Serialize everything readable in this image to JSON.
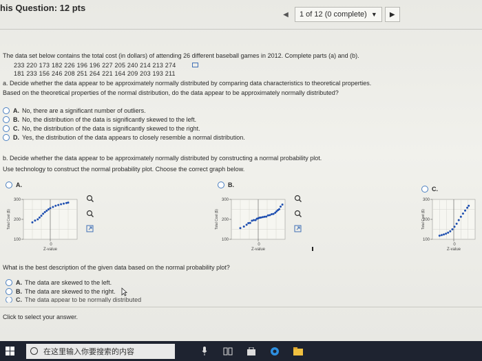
{
  "header": {
    "question_title": "his Question: 12 pts",
    "progress": "1 of 12 (0 complete)"
  },
  "intro": "The data set below contains the total cost (in dollars) of attending 26 different baseball games in 2012. Complete parts (a) and (b).",
  "data_rows": [
    "233  220  173  182  226  196  196  227  205  240  214  213  274",
    "181  233  156  246  208  251  264  221  164  209  203  193  211"
  ],
  "part_a": {
    "prompt": "a. Decide whether the data appear to be approximately normally distributed by comparing data characteristics to theoretical properties.",
    "question": "Based on the theoretical properties of the normal distribution, do the data appear to be approximately normally distributed?",
    "options": [
      {
        "letter": "A.",
        "text": "No, there are a significant number of outliers."
      },
      {
        "letter": "B.",
        "text": "No, the distribution of the data is significantly skewed to the left."
      },
      {
        "letter": "C.",
        "text": "No, the distribution of the data is significantly skewed to the right."
      },
      {
        "letter": "D.",
        "text": "Yes, the distribution of the data appears to closely resemble a normal distribution."
      }
    ]
  },
  "part_b": {
    "prompt": "b. Decide whether the data appear to be approximately normally distributed by constructing a normal probability plot.",
    "instruction": "Use technology to construct the normal probability plot. Choose the correct graph below.",
    "graph_options": [
      "A.",
      "B.",
      "C."
    ],
    "question": "What is the best description of the given data based on the normal probability plot?",
    "options": [
      {
        "letter": "A.",
        "text": "The data are skewed to the left."
      },
      {
        "letter": "B.",
        "text": "The data are skewed to the right."
      },
      {
        "letter": "C.",
        "text": "The data appear to be normally distributed"
      }
    ]
  },
  "footer_hint": "Click to select your answer.",
  "taskbar": {
    "search_placeholder": "在这里输入你要搜索的内容"
  },
  "chart_data": [
    {
      "type": "scatter",
      "title": "",
      "xlabel": "Z-value",
      "ylabel": "Total Cost ($)",
      "ylim": [
        100,
        300
      ],
      "y_ticks": [
        "300",
        "200",
        "100"
      ],
      "x_ticks": [
        "0"
      ],
      "series": [
        {
          "points": [
            [
              -2,
              185
            ],
            [
              -1.7,
              194
            ],
            [
              -1.4,
              200
            ],
            [
              -1.2,
              209
            ],
            [
              -1,
              218
            ],
            [
              -0.8,
              228
            ],
            [
              -0.6,
              236
            ],
            [
              -0.4,
              243
            ],
            [
              -0.2,
              250
            ],
            [
              0,
              256
            ],
            [
              0.3,
              262
            ],
            [
              0.6,
              268
            ],
            [
              0.9,
              272
            ],
            [
              1.2,
              276
            ],
            [
              1.5,
              279
            ],
            [
              1.8,
              282
            ],
            [
              2,
              284
            ]
          ]
        }
      ]
    },
    {
      "type": "scatter",
      "title": "",
      "xlabel": "Z-value",
      "ylabel": "Total Cost ($)",
      "ylim": [
        100,
        300
      ],
      "y_ticks": [
        "300",
        "200",
        "100"
      ],
      "x_ticks": [
        "0"
      ],
      "series": [
        {
          "points": [
            [
              -2,
              156
            ],
            [
              -1.6,
              164
            ],
            [
              -1.3,
              173
            ],
            [
              -1.1,
              181
            ],
            [
              -0.9,
              182
            ],
            [
              -0.7,
              193
            ],
            [
              -0.5,
              196
            ],
            [
              -0.3,
              196
            ],
            [
              -0.15,
              203
            ],
            [
              0,
              205
            ],
            [
              0.15,
              208
            ],
            [
              0.3,
              209
            ],
            [
              0.5,
              211
            ],
            [
              0.7,
              213
            ],
            [
              0.9,
              214
            ],
            [
              1.1,
              220
            ],
            [
              1.3,
              221
            ],
            [
              1.5,
              226
            ],
            [
              1.7,
              227
            ],
            [
              1.9,
              233
            ],
            [
              2.05,
              240
            ],
            [
              2.2,
              246
            ],
            [
              2.35,
              251
            ],
            [
              2.5,
              264
            ],
            [
              2.7,
              274
            ]
          ]
        }
      ]
    },
    {
      "type": "scatter",
      "title": "",
      "xlabel": "Z-value",
      "ylabel": "Total Cost ($)",
      "ylim": [
        100,
        300
      ],
      "y_ticks": [
        "300",
        "200",
        "100"
      ],
      "x_ticks": [
        "0"
      ],
      "series": [
        {
          "points": [
            [
              -2,
              118
            ],
            [
              -1.7,
              121
            ],
            [
              -1.4,
              124
            ],
            [
              -1.1,
              128
            ],
            [
              -0.8,
              133
            ],
            [
              -0.5,
              140
            ],
            [
              -0.2,
              150
            ],
            [
              0.1,
              163
            ],
            [
              0.4,
              178
            ],
            [
              0.7,
              196
            ],
            [
              1.0,
              213
            ],
            [
              1.3,
              229
            ],
            [
              1.6,
              244
            ],
            [
              1.9,
              258
            ],
            [
              2.1,
              268
            ]
          ]
        }
      ]
    }
  ]
}
